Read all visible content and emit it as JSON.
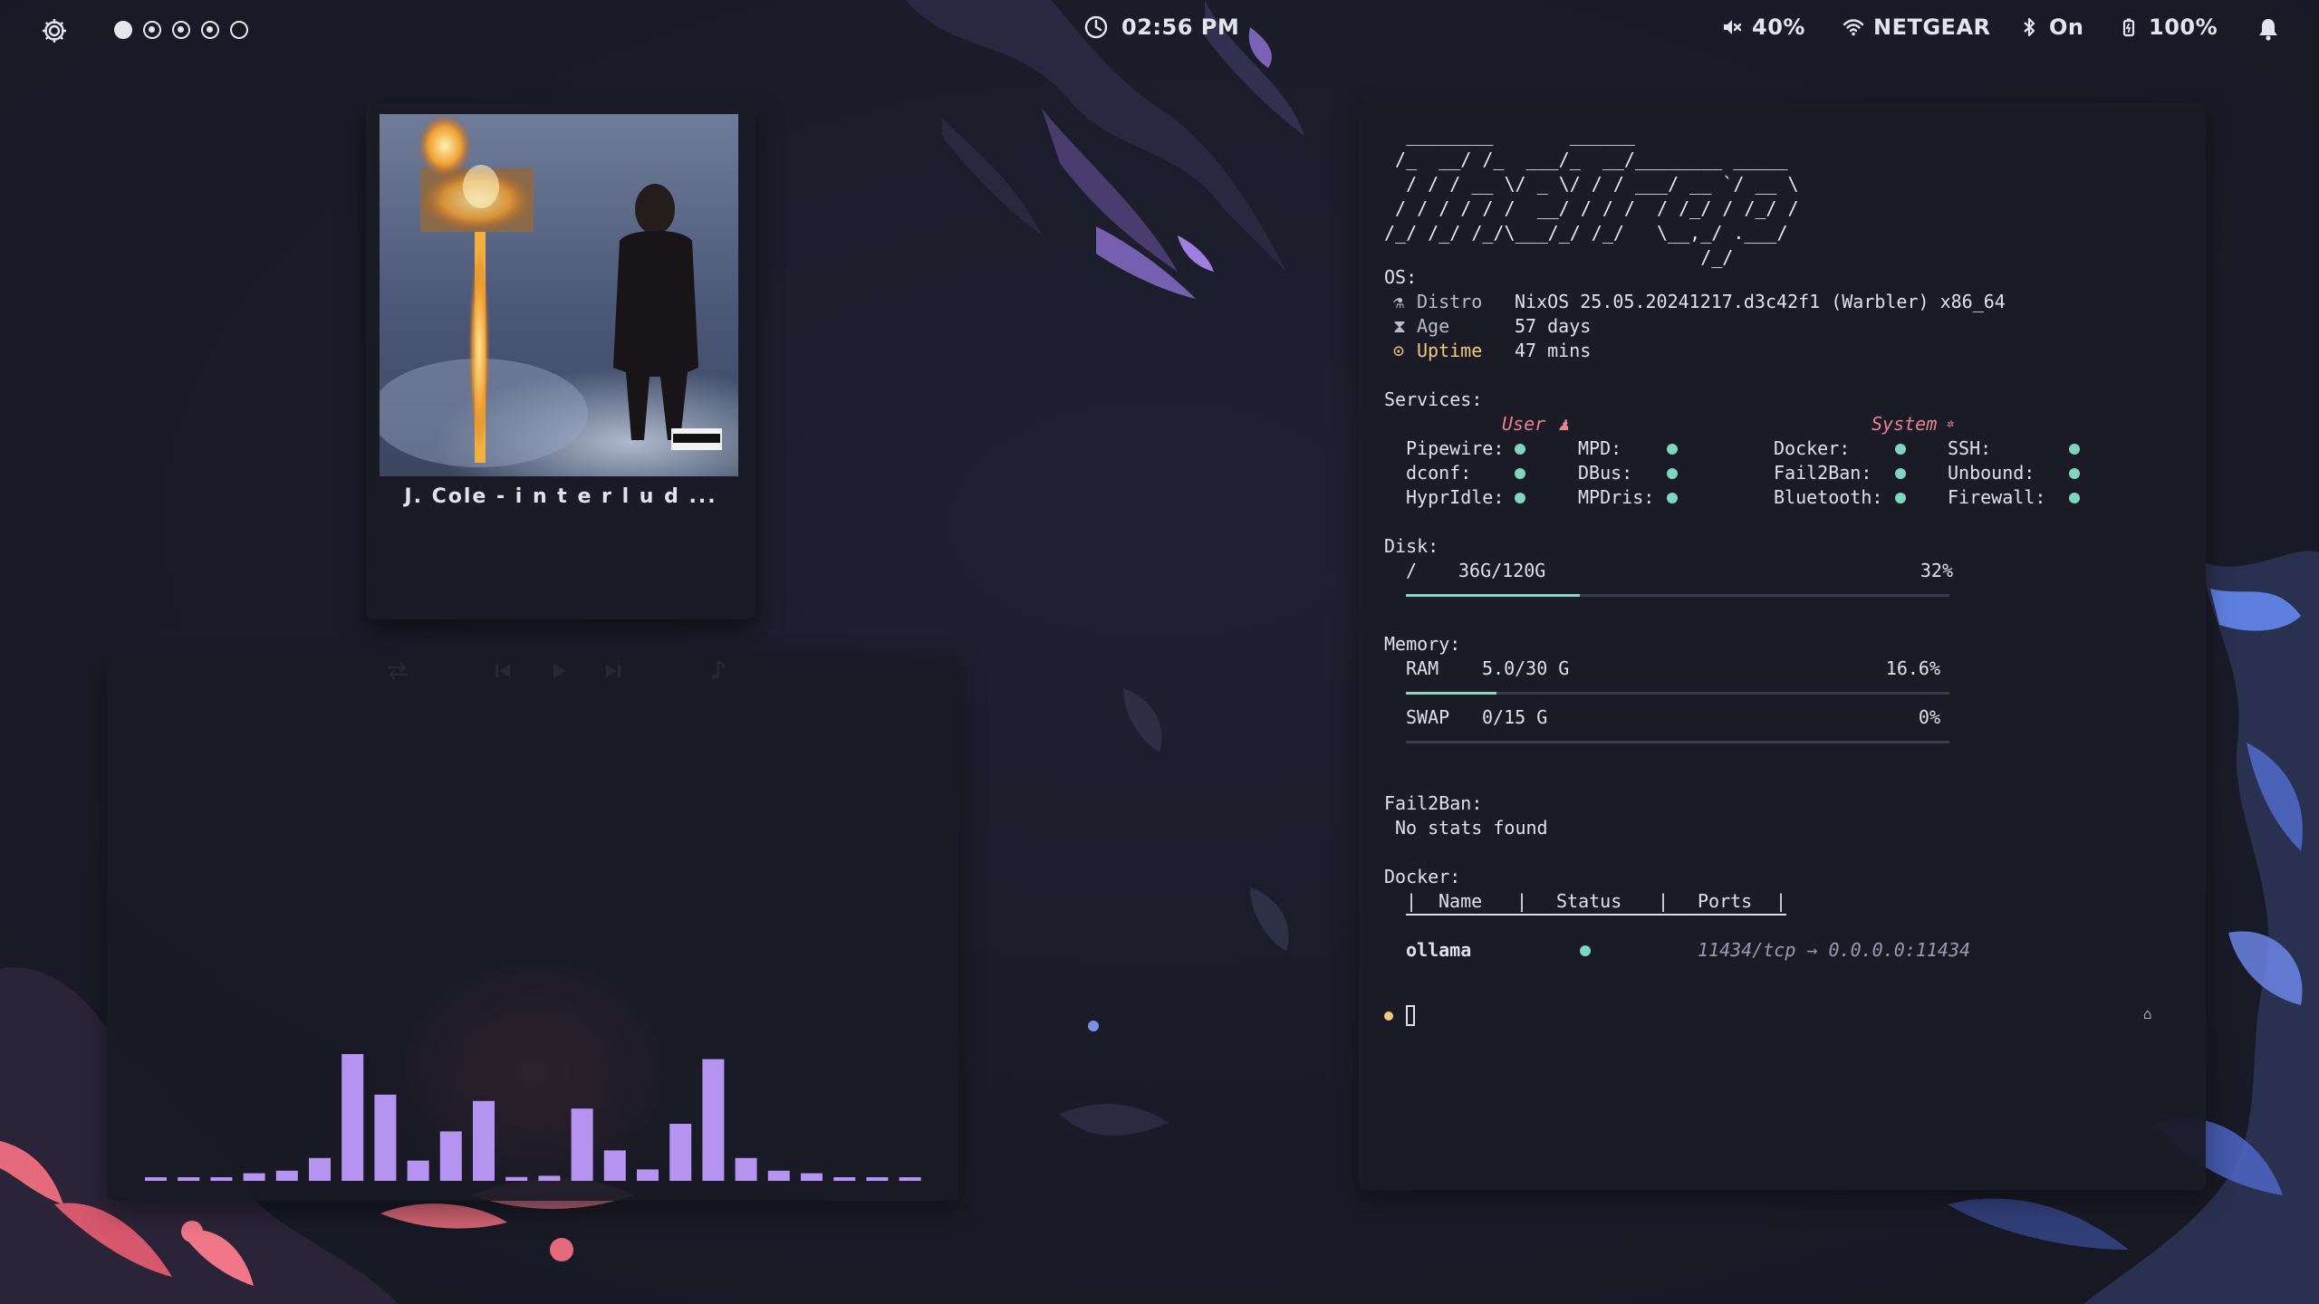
{
  "colors": {
    "background": "#1b1c2b",
    "panel": "#1a1b27",
    "visualizer_bar": "#b593f0",
    "service_ok": "#7fd6bf",
    "progress_fill": "#8ed6c4",
    "uptime_accent": "#f2c97a",
    "section_accent": "#e7828f",
    "prompt_dot": "#f2c97a"
  },
  "topbar": {
    "settings_icon": "gear-icon",
    "workspaces": [
      {
        "state": "active"
      },
      {
        "state": "occupied"
      },
      {
        "state": "occupied"
      },
      {
        "state": "occupied"
      },
      {
        "state": "empty"
      }
    ],
    "clock": {
      "icon": "clock-icon",
      "time": "02:56 PM"
    },
    "volume": {
      "icon": "volume-muted-icon",
      "value": "40%"
    },
    "wifi": {
      "icon": "wifi-icon",
      "ssid": "NETGEAR"
    },
    "bluetooth": {
      "icon": "bluetooth-icon",
      "state": "On"
    },
    "battery": {
      "icon": "battery-icon",
      "value": "100%"
    },
    "notifications_icon": "bell-icon"
  },
  "player": {
    "title": "J. Cole - i n t e r l u d ...",
    "cover_badge": "PARENTAL ADVISORY",
    "controls": [
      "repeat-icon",
      "previous-icon",
      "play-icon",
      "next-icon",
      "music-note-icon"
    ]
  },
  "visualizer": {
    "levels": [
      0.02,
      0.02,
      0.02,
      0.06,
      0.08,
      0.18,
      1.0,
      0.68,
      0.16,
      0.39,
      0.63,
      0.03,
      0.04,
      0.57,
      0.24,
      0.09,
      0.45,
      0.96,
      0.18,
      0.08,
      0.06,
      0.02,
      0.02,
      0.02
    ]
  },
  "terminal": {
    "ascii_logo": "  ________       ______\n /_  __/ /_  ___/_  __/________ _____\n  / / / __ \\/ _ \\/ / / ___/ __ `/ __ \\\n / / / / / /  __/ / / /  / /_/ / /_/ /\n/_/ /_/ /_/\\___/_/ /_/   \\__,_/ .___/\n                             /_/",
    "os": {
      "header": "OS:",
      "rows": [
        {
          "icon": "flask-icon",
          "label": "Distro",
          "value": "NixOS 25.05.20241217.d3c42f1 (Warbler) x86_64"
        },
        {
          "icon": "hourglass-icon",
          "label": "Age",
          "value": "57 days"
        },
        {
          "icon": "timer-icon",
          "label": "Uptime",
          "value": "47 mins"
        }
      ]
    },
    "services": {
      "header": "Services:",
      "user_label": "User",
      "system_label": "System",
      "user": [
        {
          "name": "Pipewire:"
        },
        {
          "name": "MPD:"
        },
        {
          "name": "dconf:"
        },
        {
          "name": "DBus:"
        },
        {
          "name": "HyprIdle:"
        },
        {
          "name": "MPDris:"
        }
      ],
      "system": [
        {
          "name": "Docker:"
        },
        {
          "name": "SSH:"
        },
        {
          "name": "Fail2Ban:"
        },
        {
          "name": "Unbound:"
        },
        {
          "name": "Bluetooth:"
        },
        {
          "name": "Firewall:"
        }
      ]
    },
    "disk": {
      "header": "Disk:",
      "mount": "/",
      "usage": "36G/120G",
      "percent": "32%",
      "fraction": 0.32
    },
    "memory": {
      "header": "Memory:",
      "ram": {
        "label": "RAM",
        "usage": "5.0/30 G",
        "percent": "16.6%",
        "fraction": 0.166
      },
      "swap": {
        "label": "SWAP",
        "usage": "0/15 G",
        "percent": "0%",
        "fraction": 0.0
      }
    },
    "fail2ban": {
      "header": "Fail2Ban:",
      "message": "No stats found"
    },
    "docker": {
      "header": "Docker:",
      "columns": [
        "Name",
        "Status",
        "Ports"
      ],
      "containers": [
        {
          "name": "ollama",
          "ports": "11434/tcp → 0.0.0.0:11434"
        }
      ]
    },
    "prompt": {
      "right_glyph": "⌂"
    }
  }
}
